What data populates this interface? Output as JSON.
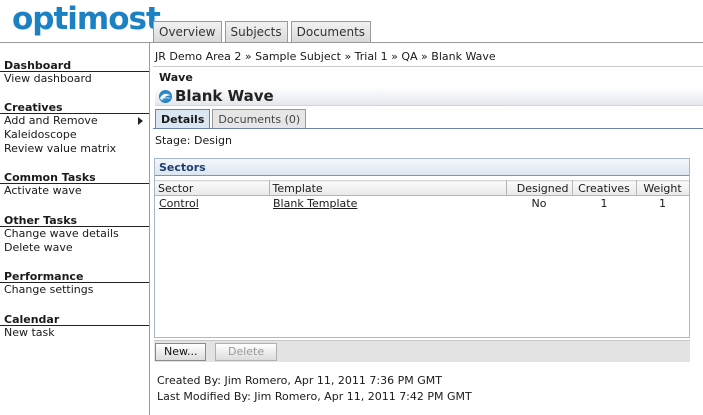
{
  "app": {
    "logo_text": "optimost"
  },
  "top_tabs": [
    "Overview",
    "Subjects",
    "Documents"
  ],
  "sidebar": {
    "groups": [
      {
        "title": "Dashboard",
        "items": [
          "View dashboard"
        ]
      },
      {
        "title": "Creatives",
        "items": [
          "Add and Remove",
          "Kaleidoscope",
          "Review value matrix"
        ]
      },
      {
        "title": "Common Tasks",
        "items": [
          "Activate wave"
        ]
      },
      {
        "title": "Other Tasks",
        "items": [
          "Change wave details",
          "Delete wave"
        ]
      },
      {
        "title": "Performance",
        "items": [
          "Change settings"
        ]
      },
      {
        "title": "Calendar",
        "items": [
          "New task"
        ]
      }
    ]
  },
  "breadcrumb": "JR Demo Area 2 » Sample Subject » Trial 1 » QA » Blank Wave",
  "page": {
    "type_label": "Wave",
    "title": "Blank Wave",
    "subtabs": [
      "Details",
      "Documents (0)"
    ],
    "stage": "Stage: Design"
  },
  "sectors": {
    "title": "Sectors",
    "columns": [
      "Sector",
      "Template",
      "Designed",
      "Creatives",
      "Weight"
    ],
    "rows": [
      {
        "sector": "Control",
        "template": "Blank Template",
        "designed": "No",
        "creatives": "1",
        "weight": "1"
      }
    ]
  },
  "buttons": {
    "new_label": "New...",
    "delete_label": "Delete"
  },
  "footer": {
    "created": "Created By: Jim Romero, Apr 11, 2011 7:36 PM GMT",
    "modified": "Last Modified By: Jim Romero, Apr 11, 2011 7:42 PM GMT"
  },
  "colors": {
    "brand": "#1b80c4",
    "section_header": "#1e3f73"
  }
}
